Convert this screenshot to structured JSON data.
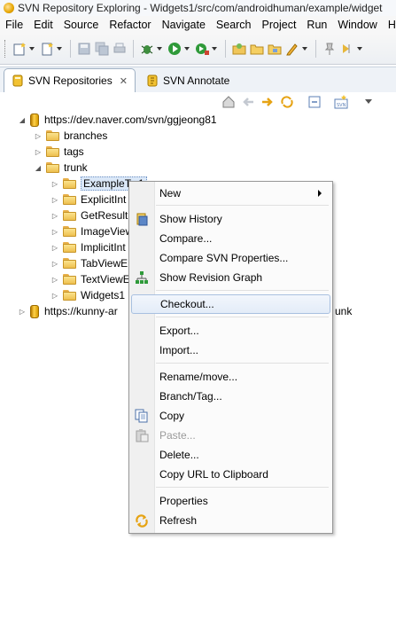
{
  "window": {
    "title": "SVN Repository Exploring - Widgets1/src/com/androidhuman/example/widget"
  },
  "menubar": [
    "File",
    "Edit",
    "Source",
    "Refactor",
    "Navigate",
    "Search",
    "Project",
    "Run",
    "Window",
    "H"
  ],
  "tabs": [
    {
      "label": "SVN Repositories",
      "active": true
    },
    {
      "label": "SVN Annotate",
      "active": false
    }
  ],
  "tree": {
    "repo1": "https://dev.naver.com/svn/ggjeong81",
    "branches": "branches",
    "tags": "tags",
    "trunk": "trunk",
    "children": [
      "ExampleTw1",
      "ExplicitInt",
      "GetResult",
      "ImageView",
      "ImplicitInt",
      "TabViewE",
      "TextViewE",
      "Widgets1"
    ],
    "repo2_prefix": "https://kunny-ar",
    "repo2_suffix": "unk"
  },
  "context_menu": {
    "new": "New",
    "show_history": "Show History",
    "compare": "Compare...",
    "compare_props": "Compare SVN Properties...",
    "revision_graph": "Show Revision Graph",
    "checkout": "Checkout...",
    "export": "Export...",
    "import": "Import...",
    "rename": "Rename/move...",
    "branch": "Branch/Tag...",
    "copy": "Copy",
    "paste": "Paste...",
    "delete": "Delete...",
    "copy_url": "Copy URL to Clipboard",
    "properties": "Properties",
    "refresh": "Refresh"
  }
}
